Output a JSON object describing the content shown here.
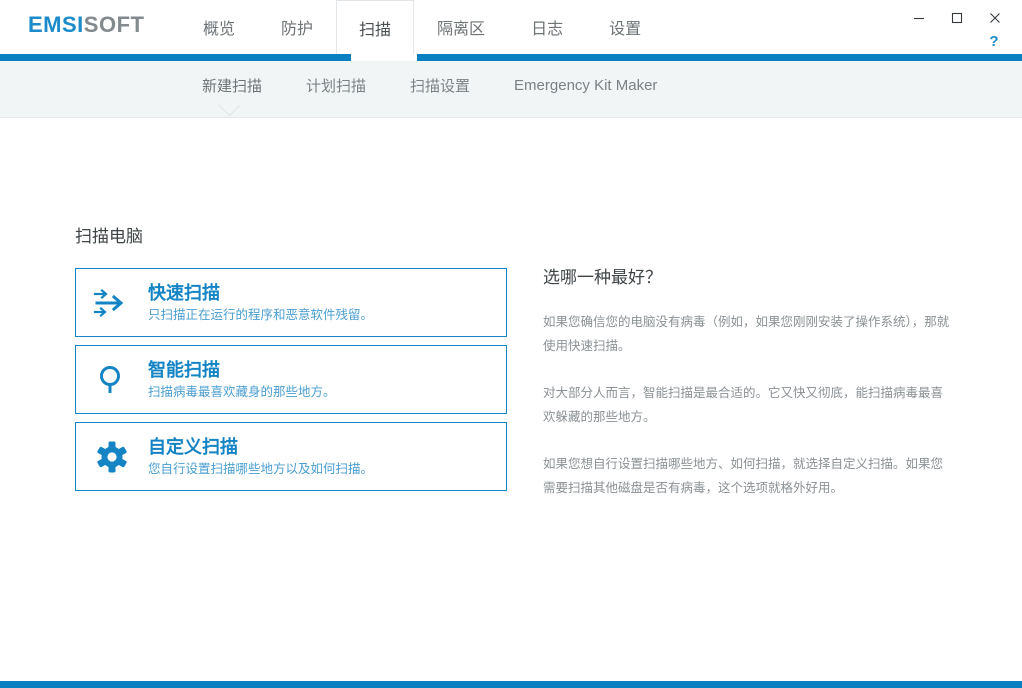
{
  "app": {
    "logo_primary": "EMSI",
    "logo_secondary": "SOFT",
    "accent_color": "#0b80c0",
    "link_color": "#1484c4"
  },
  "window_controls": {
    "minimize": "minimize-icon",
    "maximize": "maximize-icon",
    "close": "close-icon",
    "help_label": "?"
  },
  "mainnav": {
    "items": [
      {
        "label": "概览",
        "active": false
      },
      {
        "label": "防护",
        "active": false
      },
      {
        "label": "扫描",
        "active": true
      },
      {
        "label": "隔离区",
        "active": false
      },
      {
        "label": "日志",
        "active": false
      },
      {
        "label": "设置",
        "active": false
      }
    ]
  },
  "subnav": {
    "items": [
      {
        "label": "新建扫描",
        "active": true
      },
      {
        "label": "计划扫描",
        "active": false
      },
      {
        "label": "扫描设置",
        "active": false
      },
      {
        "label": "Emergency Kit Maker",
        "active": false
      }
    ]
  },
  "main": {
    "page_title": "扫描电脑",
    "cards": [
      {
        "icon": "arrows-right-icon",
        "title": "快速扫描",
        "desc": "只扫描正在运行的程序和恶意软件残留。"
      },
      {
        "icon": "magnifier-icon",
        "title": "智能扫描",
        "desc": "扫描病毒最喜欢藏身的那些地方。"
      },
      {
        "icon": "gear-icon",
        "title": "自定义扫描",
        "desc": "您自行设置扫描哪些地方以及如何扫描。"
      }
    ]
  },
  "side": {
    "heading": "选哪一种最好？",
    "paragraphs": [
      "如果您确信您的电脑没有病毒（例如，如果您刚刚安装了操作系统），那就使用快速扫描。",
      "对大部分人而言，智能扫描是最合适的。它又快又彻底，能扫描病毒最喜欢躲藏的那些地方。",
      "如果您想自行设置扫描哪些地方、如何扫描，就选择自定义扫描。如果您需要扫描其他磁盘是否有病毒，这个选项就格外好用。"
    ]
  }
}
